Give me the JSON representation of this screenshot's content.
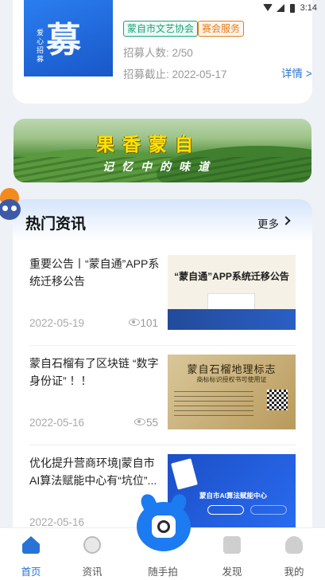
{
  "status_bar": {
    "time": "3:14"
  },
  "recruit": {
    "thumb_big_char": "募",
    "thumb_vertical_text": "爱心招募",
    "tags": [
      "蒙自市文艺协会",
      "赛会服务"
    ],
    "count": "招募人数: 2/50",
    "deadline": "招募截止: 2022-05-17",
    "detail_label": "详情 >"
  },
  "banner": {
    "title": "果香蒙自",
    "subtitle": "记忆中的味道"
  },
  "news": {
    "title": "热门资讯",
    "more_label": "更多",
    "items": [
      {
        "title": "重要公告丨“蒙自通”APP系统迁移公告",
        "date": "2022-05-19",
        "views": "101",
        "thumb_caption": "“蒙自通”APP系统迁移公告"
      },
      {
        "title": "蒙自石榴有了区块链 “数字身份证” ！！",
        "date": "2022-05-16",
        "views": "55",
        "thumb_caption": "蒙自石榴地理标志",
        "thumb_sub": "商标标识授权书可使用证"
      },
      {
        "title": "优化提升营商环境|蒙自市AI算法赋能中心有“坑位”...",
        "date": "2022-05-16",
        "views": "",
        "thumb_caption": "蒙自市AI算法赋能中心"
      }
    ]
  },
  "tabbar": {
    "tabs": [
      {
        "label": "首页",
        "icon": "home-icon",
        "active": true
      },
      {
        "label": "资讯",
        "icon": "compass-icon",
        "active": false
      },
      {
        "label": "随手拍",
        "icon": "camera-icon",
        "active": false
      },
      {
        "label": "发现",
        "icon": "discover-icon",
        "active": false
      },
      {
        "label": "我的",
        "icon": "user-icon",
        "active": false
      }
    ],
    "active_color": "#2a73d6"
  }
}
